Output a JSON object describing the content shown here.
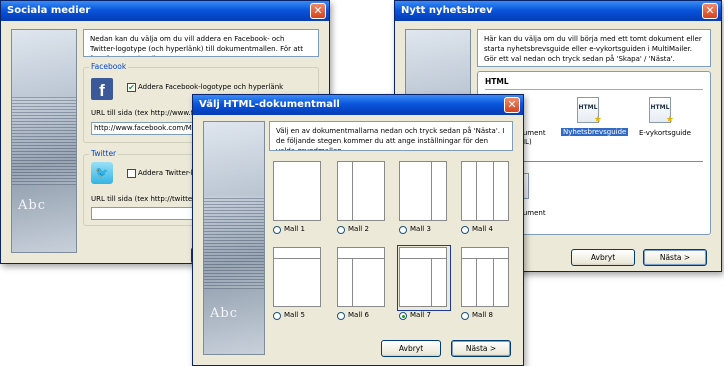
{
  "social": {
    "title": "Sociala medier",
    "info": "Nedan kan du välja om du vill addera en Facebook- och Twitter-logotype (och hyperlänk) till dokumentmallen. För att fortsätta, tryck 'Nästa'.",
    "facebook": {
      "group_label": "Facebook",
      "checkbox_label": "Addera Facebook-logotype och hyperlänk",
      "url_label": "URL till sida (tex http://www.faceb",
      "url_value": "http://www.facebook.com/MyFace"
    },
    "twitter": {
      "group_label": "Twitter",
      "checkbox_label": "Addera Twitter-logot",
      "url_label": "URL till sida (tex http://twitter.com/",
      "url_value": ""
    }
  },
  "newsletter": {
    "title": "Nytt nyhetsbrev",
    "info": "Här kan du välja om du vill börja med ett tomt dokument eller starta nyhetsbrevsguide eller e-vykortsguiden i MultiMailer. Gör ett val nedan och tryck sedan på 'Skapa' / 'Nästa'.",
    "section": "HTML",
    "icons": [
      {
        "label": "Nyhetsbrevsguide",
        "glyph": "HTML"
      },
      {
        "label": "E-vykortsguide",
        "glyph": "HTML"
      }
    ],
    "partial_labels": [
      "kument",
      "ML)",
      "kument"
    ],
    "cancel": "Avbryt",
    "next": "Nästa >"
  },
  "templates": {
    "title": "Välj HTML-dokumentmall",
    "info": "Välj en av dokumentmallarna nedan och tryck sedan på 'Nästa'. I de följande stegen kommer du att ange inställningar för den valda grundmallen.",
    "options": [
      "Mall 1",
      "Mall 2",
      "Mall 3",
      "Mall 4",
      "Mall 5",
      "Mall 6",
      "Mall 7",
      "Mall 8"
    ],
    "selected": "Mall 7",
    "cancel": "Avbryt",
    "next": "Nästa >"
  },
  "side_image_text": "Abc",
  "colors": {
    "titlebar": "#0a56dc",
    "close": "#d5441c",
    "dialog_bg": "#ece9d8",
    "group_label": "#0046d5",
    "selection": "#316ac5"
  }
}
